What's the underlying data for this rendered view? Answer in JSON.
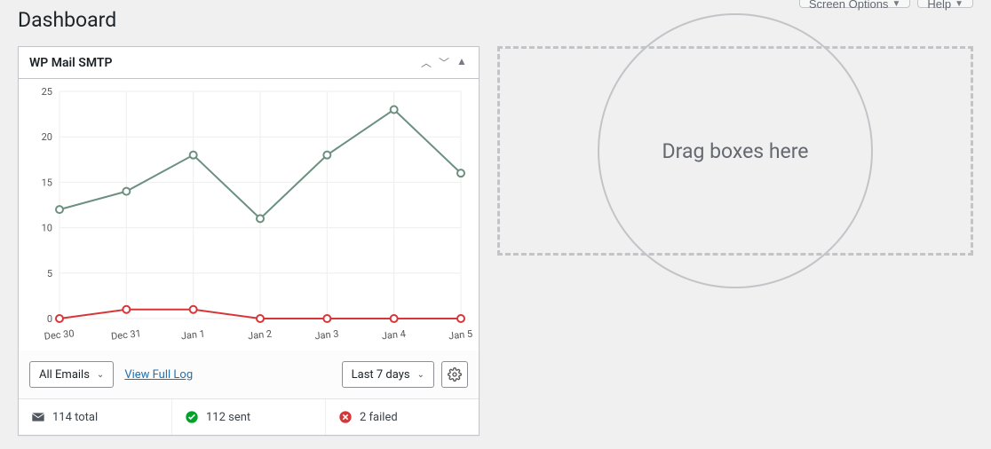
{
  "header": {
    "screen_options": "Screen Options",
    "help": "Help",
    "title": "Dashboard"
  },
  "widget": {
    "title": "WP Mail SMTP",
    "filter_select": "All Emails",
    "view_log_link": "View Full Log",
    "range_select": "Last 7 days"
  },
  "stats": {
    "total": "114 total",
    "sent": "112 sent",
    "failed": "2 failed"
  },
  "drop_label": "Drag boxes here",
  "chart_data": {
    "type": "line",
    "categories": [
      "Dec 30",
      "Dec 31",
      "Jan 1",
      "Jan 2",
      "Jan 3",
      "Jan 4",
      "Jan 5"
    ],
    "ylabel": "",
    "ylim": [
      0,
      25
    ],
    "yticks": [
      0,
      5,
      10,
      15,
      20,
      25
    ],
    "series": [
      {
        "name": "sent",
        "color": "#6b9080",
        "values": [
          12,
          14,
          18,
          11,
          18,
          23,
          16
        ]
      },
      {
        "name": "failed",
        "color": "#d63638",
        "values": [
          0,
          1,
          1,
          0,
          0,
          0,
          0
        ]
      }
    ]
  }
}
